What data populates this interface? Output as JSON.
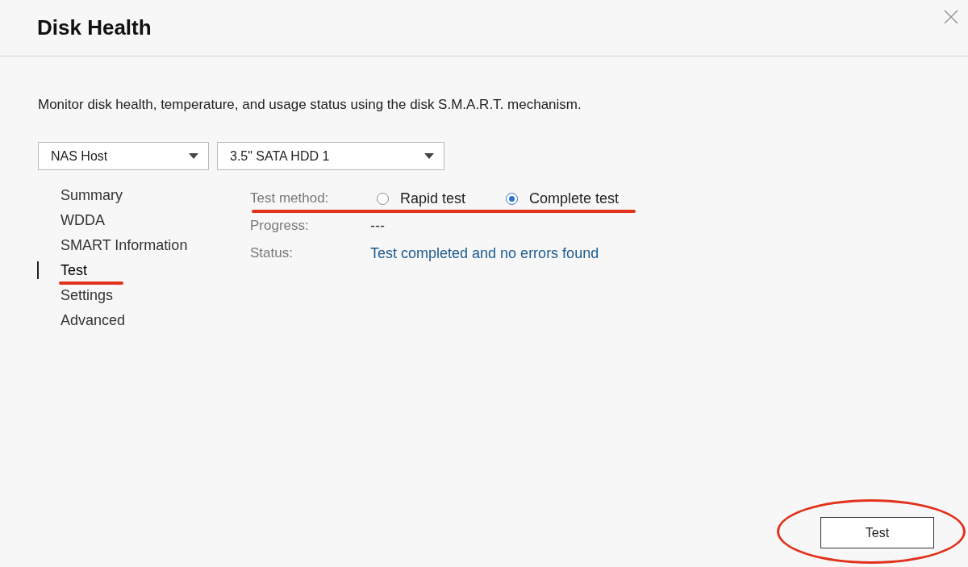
{
  "window": {
    "title": "Disk Health"
  },
  "description": "Monitor disk health, temperature, and usage status using the disk S.M.A.R.T. mechanism.",
  "selectors": [
    {
      "value": "NAS Host"
    },
    {
      "value": "3.5\" SATA HDD 1"
    }
  ],
  "nav": {
    "items": [
      {
        "label": "Summary",
        "selected": false
      },
      {
        "label": "WDDA",
        "selected": false
      },
      {
        "label": "SMART Information",
        "selected": false
      },
      {
        "label": "Test",
        "selected": true
      },
      {
        "label": "Settings",
        "selected": false
      },
      {
        "label": "Advanced",
        "selected": false
      }
    ]
  },
  "test": {
    "method_label": "Test method:",
    "methods": [
      {
        "label": "Rapid test",
        "selected": false
      },
      {
        "label": "Complete test",
        "selected": true
      }
    ],
    "progress_label": "Progress:",
    "progress_value": "---",
    "status_label": "Status:",
    "status_value": "Test completed and no errors found"
  },
  "button": "Test"
}
